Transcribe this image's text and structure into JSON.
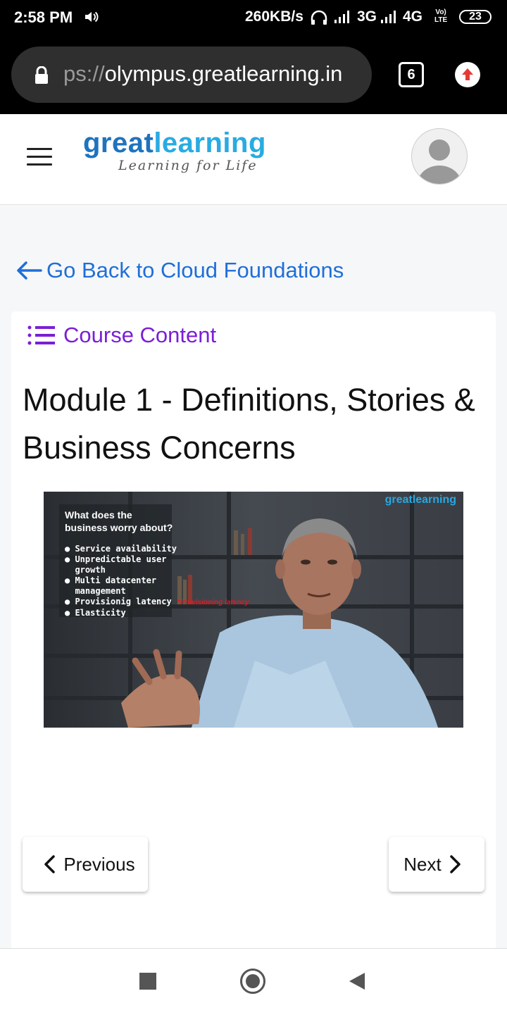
{
  "status_bar": {
    "time": "2:58 PM",
    "speed": "260KB/s",
    "network_1": "3G",
    "network_2": "4G",
    "volte_top": "Vo)",
    "volte_bottom": "LTE",
    "battery": "23"
  },
  "browser": {
    "url_prefix": "ps://",
    "url_host": "olympus.greatlearning.in",
    "tab_count": "6"
  },
  "header": {
    "logo_part1": "great",
    "logo_part2": "learning",
    "logo_tagline": "Learning for Life"
  },
  "back_link": "Go Back to Cloud Foundations",
  "course_content_label": "Course Content",
  "module_title": "Module 1 - Definitions, Stories & Business Concerns",
  "video": {
    "heading_line1": "What does the",
    "heading_line2": "business worry about?",
    "bullets": [
      "Service availability",
      "Unpredictable user",
      "growth",
      "Multi datacenter",
      "management",
      "Provisionig latency",
      "Elasticity"
    ],
    "annotation": "*Provisioning latency",
    "watermark": "greatlearning"
  },
  "nav": {
    "previous_label": "Previous",
    "next_label": "Next"
  },
  "colors": {
    "link_blue": "#1e6fd9",
    "course_purple": "#7a1fd6",
    "logo_dark_blue": "#1e73be",
    "logo_light_blue": "#29abe2"
  }
}
